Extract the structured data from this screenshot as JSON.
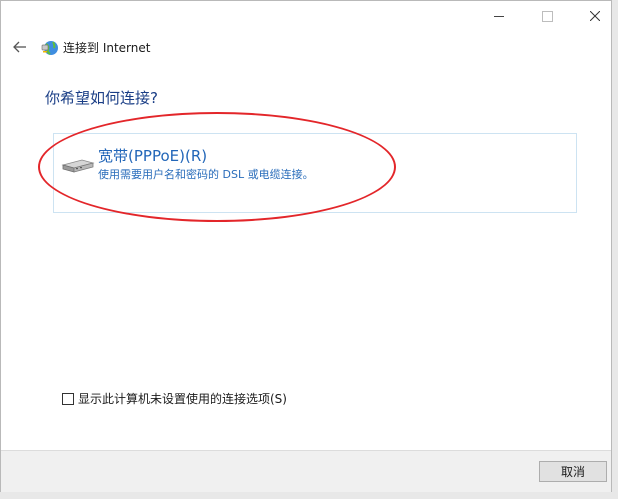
{
  "window": {
    "title": "连接到 Internet"
  },
  "heading": "你希望如何连接?",
  "option": {
    "title": "宽带(PPPoE)(R)",
    "description": "使用需要用户名和密码的 DSL 或电缆连接。",
    "icon": "broadband-device-icon"
  },
  "checkbox": {
    "label": "显示此计算机未设置使用的连接选项(S)",
    "checked": false
  },
  "footer": {
    "cancel_label": "取消"
  },
  "colors": {
    "heading": "#1a3e86",
    "option_text": "#2266b8",
    "highlight_ellipse": "#e3262a"
  }
}
